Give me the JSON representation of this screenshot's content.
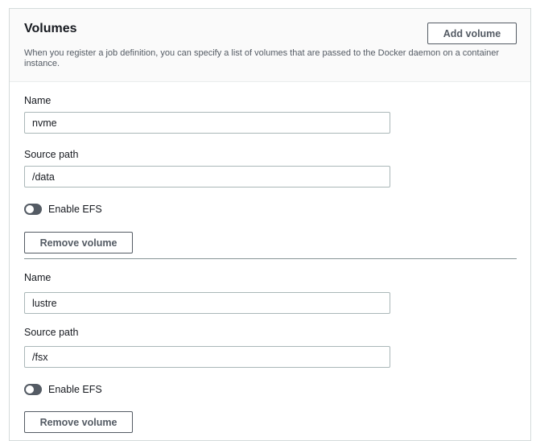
{
  "volumes_panel": {
    "title": "Volumes",
    "description": "When you register a job definition, you can specify a list of volumes that are passed to the Docker daemon on a container instance.",
    "add_button_label": "Add volume"
  },
  "volumes": [
    {
      "name_label": "Name",
      "name_value": "nvme",
      "source_path_label": "Source path",
      "source_path_value": "/data",
      "efs_toggle_label": "Enable EFS",
      "efs_enabled": false,
      "remove_button_label": "Remove volume"
    },
    {
      "name_label": "Name",
      "name_value": "lustre",
      "source_path_label": "Source path",
      "source_path_value": "/fsx",
      "efs_toggle_label": "Enable EFS",
      "efs_enabled": false,
      "remove_button_label": "Remove volume"
    }
  ],
  "colors": {
    "header_bg": "#fafafa",
    "border": "#d5dbdb",
    "text": "#16191f",
    "muted_text": "#545b64",
    "input_border": "#aab7b8",
    "toggle_off": "#545b64"
  },
  "icons": {
    "toggle": "toggle-switch-off-icon"
  }
}
